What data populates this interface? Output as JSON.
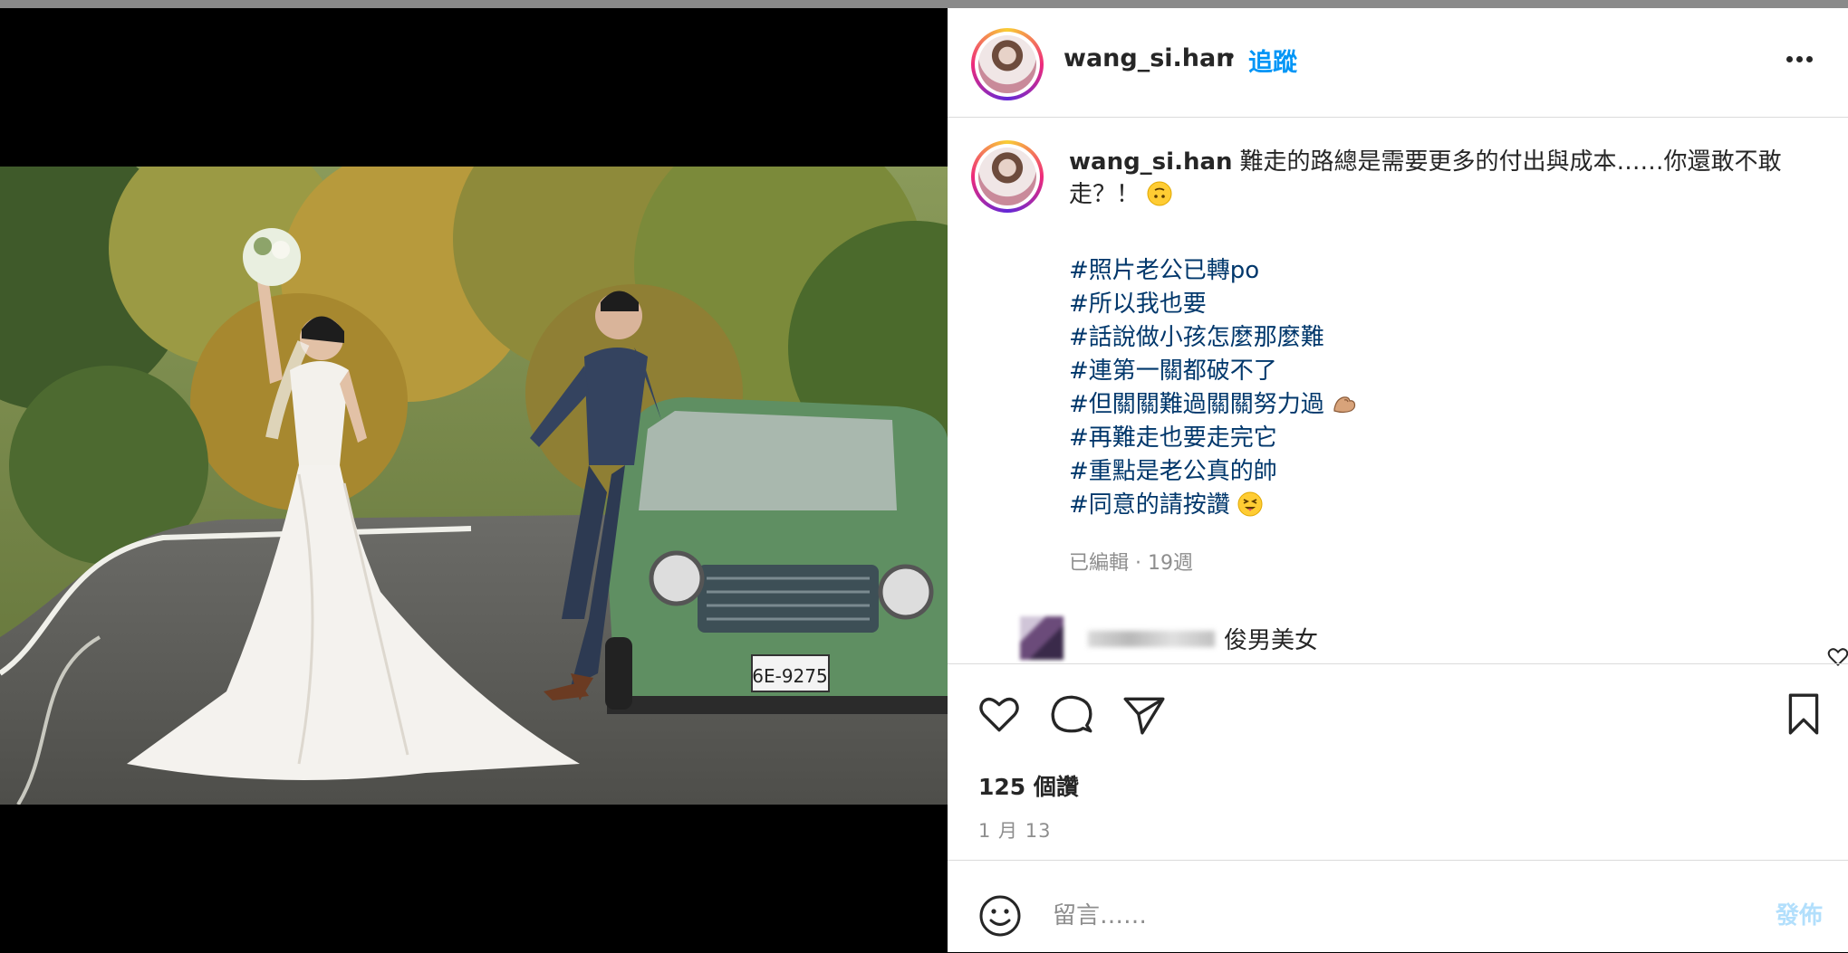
{
  "post": {
    "username": "wang_si.han",
    "follow_label": "追蹤",
    "separator": "•",
    "caption": {
      "username": "wang_si.han",
      "text": "難走的路總是需要更多的付出與成本……你還敢不敢走？！",
      "emoji": "upside-down-face"
    },
    "hashtags": [
      {
        "text": "#照片老公已轉po",
        "emoji": ""
      },
      {
        "text": "#所以我也要",
        "emoji": ""
      },
      {
        "text": "#話說做小孩怎麼那麼難",
        "emoji": ""
      },
      {
        "text": "#連第一關都破不了",
        "emoji": ""
      },
      {
        "text": "#但關關難過關關努力過",
        "emoji": "flexed-biceps"
      },
      {
        "text": "#再難走也要走完它",
        "emoji": ""
      },
      {
        "text": "#重點是老公真的帥",
        "emoji": ""
      },
      {
        "text": "#同意的請按讚",
        "emoji": "squinting-tongue-face"
      }
    ],
    "edited_meta": "已編輯 · 19週",
    "comment": {
      "text": "俊男美女"
    },
    "likes": "125 個讚",
    "date": "1 月 13",
    "composer": {
      "placeholder": "留言……",
      "post_label": "發佈"
    }
  },
  "icons": {
    "like": "heart-icon",
    "comment": "comment-bubble-icon",
    "share": "paper-plane-icon",
    "save": "bookmark-icon",
    "emoji": "smiley-icon",
    "more": "more-horizontal-icon"
  },
  "colors": {
    "link_blue": "#0095f6",
    "hashtag": "#00376b",
    "muted": "#8e8e8e",
    "post_disabled": "#b2dffc",
    "car_green": "#5a8a5a"
  }
}
